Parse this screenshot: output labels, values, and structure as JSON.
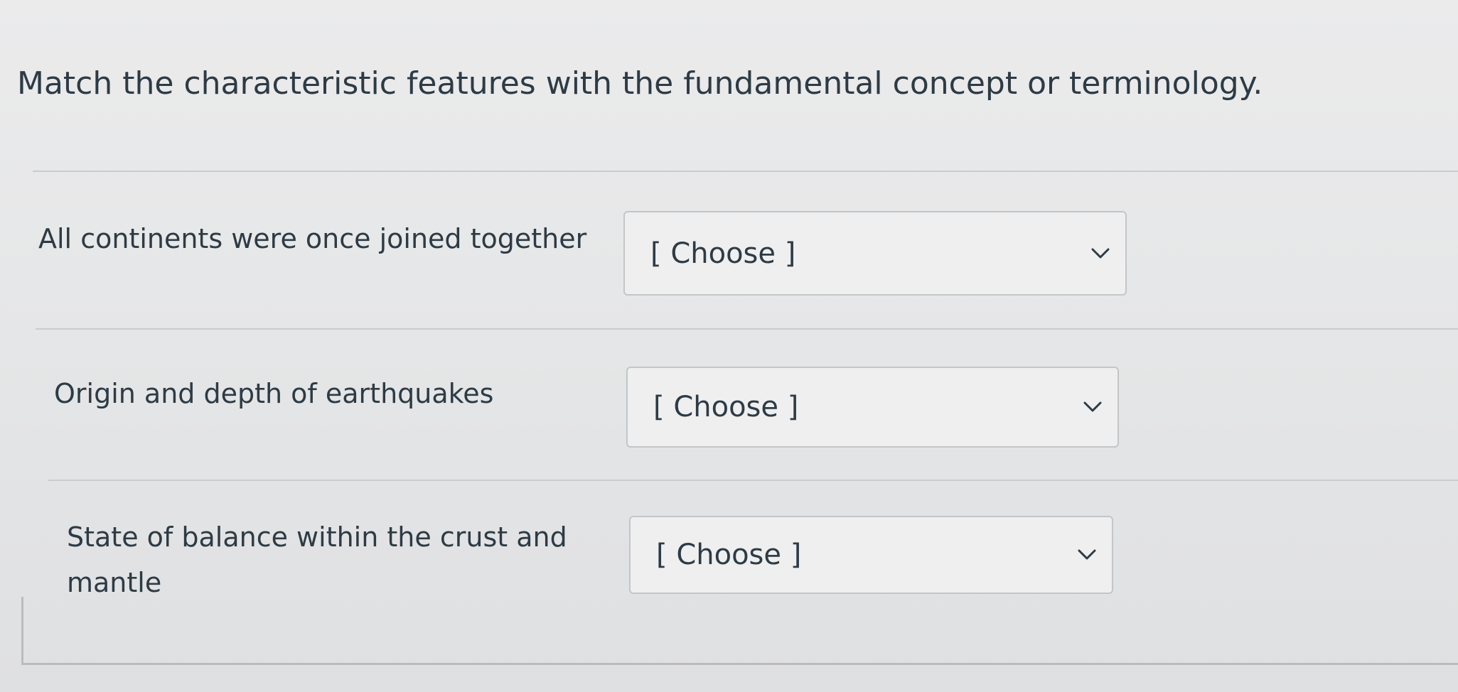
{
  "question": {
    "text": "Match the characteristic features with the fundamental concept or terminology."
  },
  "rows": [
    {
      "label": "All continents were once joined together",
      "selected": "[ Choose ]",
      "icon": "chevron-down-icon"
    },
    {
      "label": "Origin and depth of earthquakes",
      "selected": "[ Choose ]",
      "icon": "chevron-down-icon"
    },
    {
      "label": "State of balance within the crust and mantle",
      "selected": "[ Choose ]",
      "icon": "chevron-down-icon"
    }
  ]
}
